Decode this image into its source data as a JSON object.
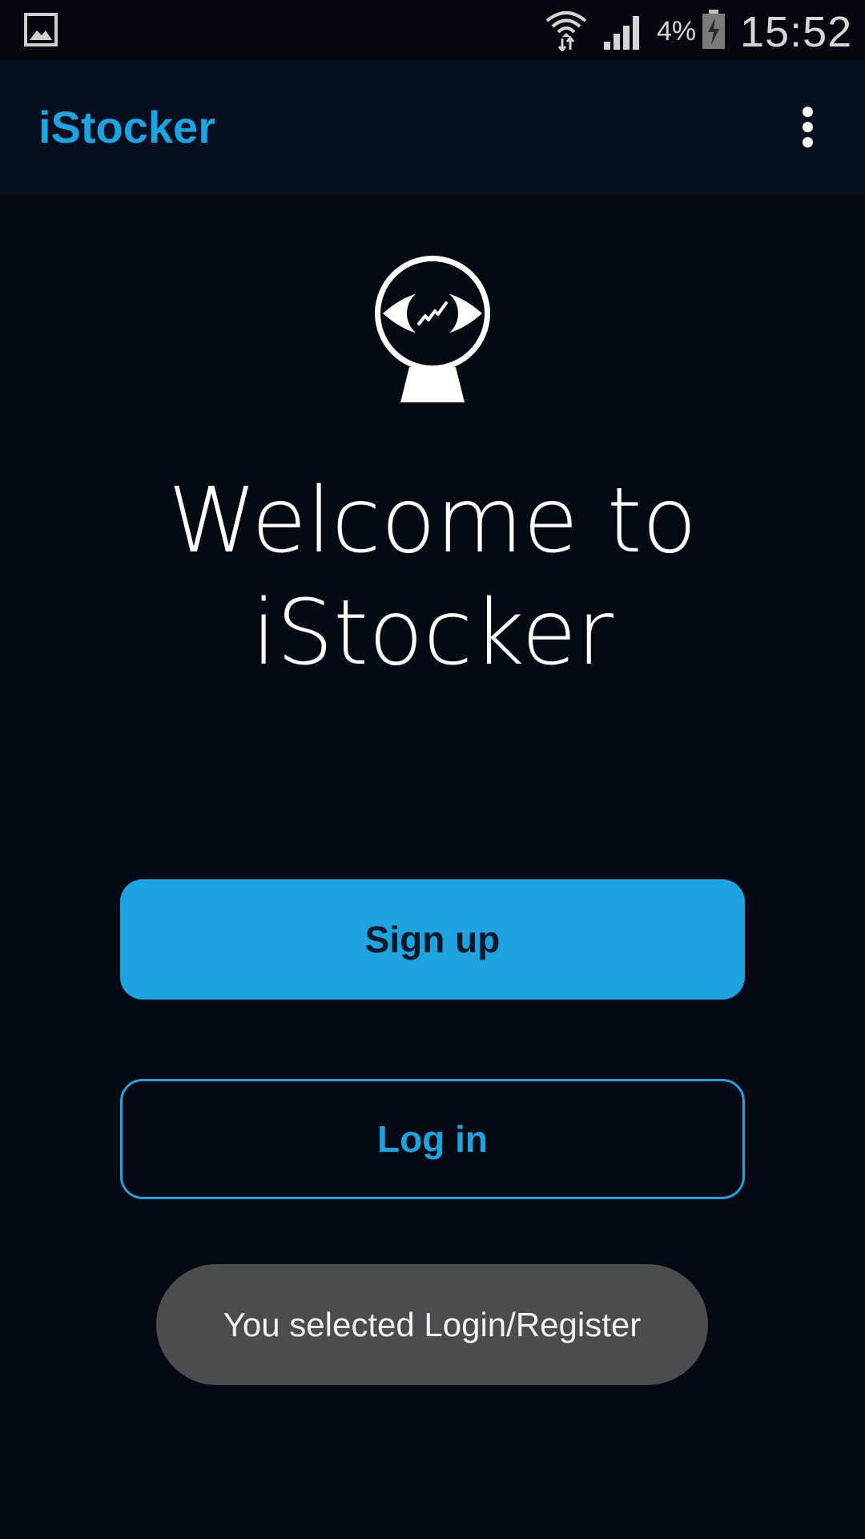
{
  "status_bar": {
    "battery_percent": "4%",
    "time": "15:52",
    "icons": [
      "gallery-icon",
      "wifi-icon",
      "cell-signal-icon",
      "battery-charging-icon"
    ]
  },
  "app_bar": {
    "title": "iStocker",
    "menu_icon": "overflow-menu-icon"
  },
  "welcome": {
    "line1": "Welcome to",
    "line2": "iStocker"
  },
  "buttons": {
    "signup_label": "Sign up",
    "login_label": "Log in"
  },
  "toast": {
    "message": "You selected Login/Register"
  },
  "colors": {
    "accent": "#1ca3e0",
    "background": "#050a12",
    "app_bar": "#04101f",
    "toast": "#4b4c4e"
  }
}
